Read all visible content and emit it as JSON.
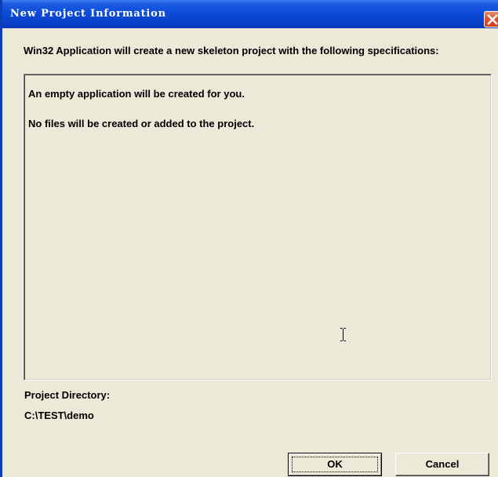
{
  "window": {
    "title": "New Project Information",
    "close_icon": "close-icon"
  },
  "intro": {
    "text": "Win32 Application will create a new skeleton project with the following specifications:"
  },
  "info_box": {
    "lines": [
      "An empty application will be created for you.",
      "No files will be created or added to the project."
    ],
    "cursor_icon": "text-cursor-icon"
  },
  "project_directory": {
    "label": "Project Directory:",
    "value": "C:\\TEST\\demo"
  },
  "buttons": {
    "ok_label": "OK",
    "cancel_label": "Cancel"
  },
  "colors": {
    "titlebar": "#0a48d6",
    "dialog_bg": "#ece9d8",
    "close_button": "#d9552f"
  }
}
